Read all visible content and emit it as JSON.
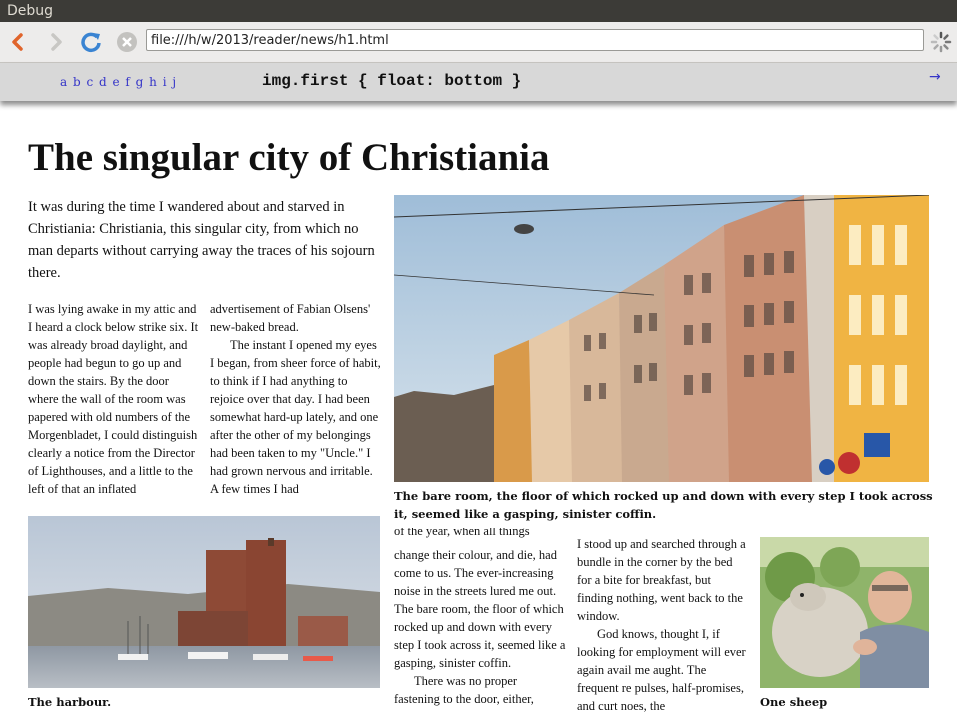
{
  "window": {
    "title": "Debug"
  },
  "toolbar": {
    "back_icon": "back-arrow-icon",
    "forward_icon": "forward-arrow-icon",
    "reload_icon": "reload-icon",
    "stop_icon": "stop-icon",
    "url": "file:///h/w/2013/reader/news/h1.html",
    "loading_icon": "spinner-icon"
  },
  "debugbar": {
    "letters": "a b c d e f g h i j",
    "rule": "img.first { float: bottom }",
    "next_arrow": "→"
  },
  "article": {
    "title": "The singular city of Christiania",
    "intro": "It was during the time I wandered about and starved in Christiania: Christiania, this singular city, from which no man departs without carrying away the traces of his sojourn there.",
    "col1": "I was lying awake in my attic and I heard a clock below strike six. It was already broad daylight, and people had begun to go up and down the stairs. By the door where the wall of the room was papered with old numbers of the Morgenbladet, I could distinguish clearly a notice from the Director of Lighthouses, and a little to the left of that an inflated",
    "col2_p1": "advertisement of Fabian Olsens' new-baked bread.",
    "col2_p2": "The instant I opened my eyes I began, from sheer force of habit, to think if I had anything to rejoice over that day. I had been somewhat hard-up lately, and one after the other of my belongings had been taken to my \"Uncle.\" I had grown nervous and irritable. A few times I had",
    "col3_top": "of the year, when all things",
    "col3_p1": "change their colour, and die, had come to us. The ever-increasing noise in the streets lured me out. The bare room, the floor of which rocked up and down with every step I took across it, seemed like a gasping, sinister coffin.",
    "col3_p2": "There was no proper fastening to the door, either,",
    "col4_p1": "I stood up and searched through a bundle in the corner by the bed for a bite for breakfast, but finding nothing, went back to the window.",
    "col4_p2": "God knows, thought I, if looking for employment will ever again avail me aught. The frequent re pulses, half-promises, and curt noes, the",
    "caption_main": "The bare room, the floor of which rocked up and down with every step I took across it, seemed like a gasping, sinister coffin.",
    "caption_harbour": "The harbour.",
    "caption_sheep": "One sheep"
  },
  "colors": {
    "link": "#3434c8",
    "titlebar": "#3c3b37",
    "toolbar": "#edeceb",
    "debugbar": "#d8d8d8"
  }
}
